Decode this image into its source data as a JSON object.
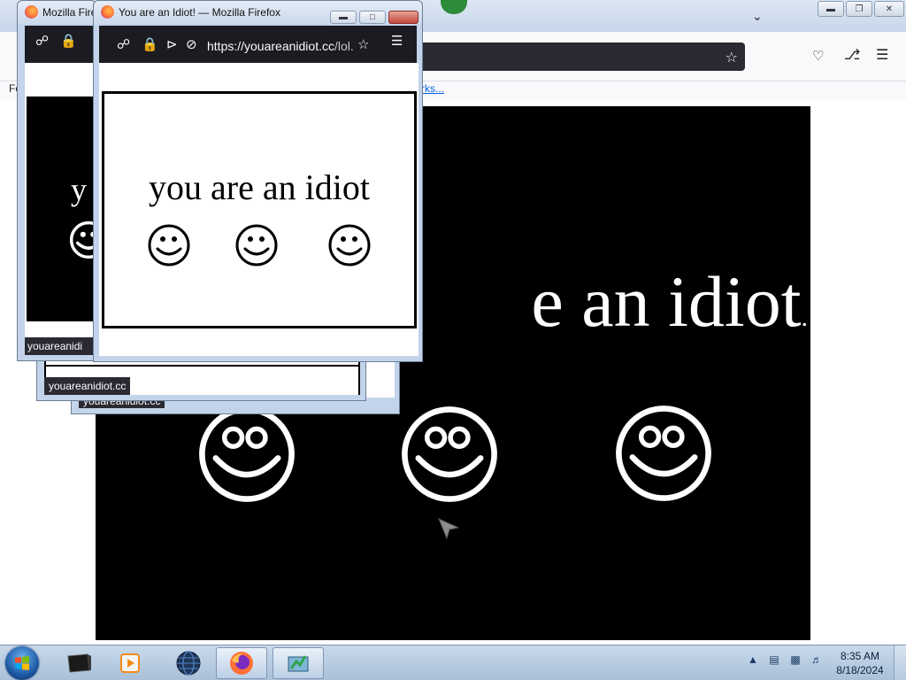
{
  "main_window": {
    "bookmarks_left_text": "Fo",
    "bookmarks_link": "rks...",
    "page_text": "e an idiot",
    "page_text_tail": "."
  },
  "popups": {
    "front": {
      "title": "You are an Idiot! — Mozilla Firefox",
      "url_host": "https://youareanidiot.cc",
      "url_path": "/lol.",
      "heading": "you are an idiot"
    },
    "left": {
      "title": "Mozilla Firef",
      "page_text": "y",
      "status": "youareanidi"
    },
    "back1": {
      "status": "youareanidiot.cc"
    },
    "back2": {
      "status": "youareanidiot.cc"
    }
  },
  "taskbar": {
    "time": "8:35 AM",
    "date": "8/18/2024",
    "items": [
      "start-menu",
      "terminal",
      "media-player",
      "browser-globe",
      "firefox",
      "app-window"
    ]
  },
  "colors": {
    "firefox_dark": "#1c1b22",
    "page_black": "#000000",
    "taskbar": "#b9cde3"
  }
}
